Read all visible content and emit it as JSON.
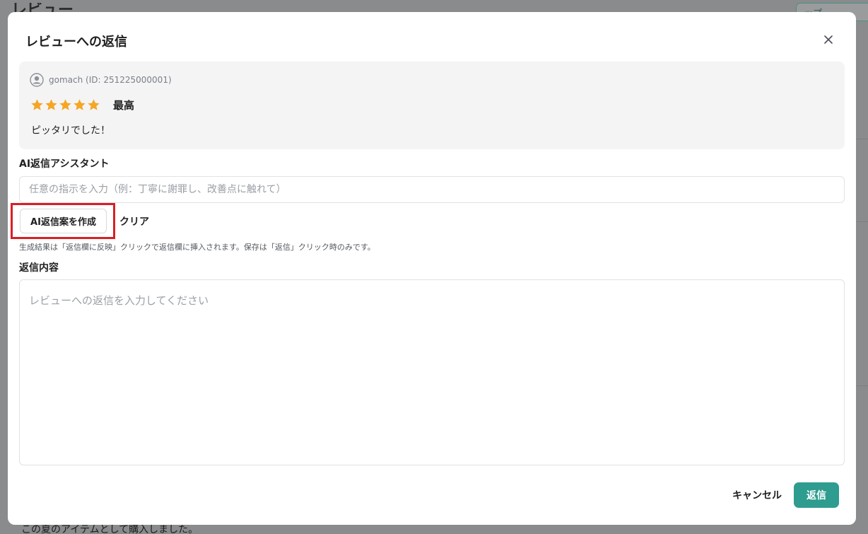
{
  "background": {
    "title": "レビュー",
    "top_button": "ップ",
    "bottom_text": "この夏のアイテムとして購入しました。"
  },
  "modal": {
    "title": "レビューへの返信",
    "close_icon": "close-icon"
  },
  "review": {
    "reviewer": "gomach (ID: 251225000001)",
    "rating": 5,
    "rating_label": "最高",
    "body": "ピッタリでした！",
    "star_color": "#f5a623"
  },
  "ai_assistant": {
    "label": "AI返信アシスタント",
    "input_value": "",
    "input_placeholder": "任意の指示を入力（例：丁寧に謝罪し、改善点に触れて）",
    "generate_label": "AI返信案を作成",
    "clear_label": "クリア",
    "helper_text": "生成結果は「返信欄に反映」クリックで返信欄に挿入されます。保存は「返信」クリック時のみです。"
  },
  "reply": {
    "label": "返信内容",
    "value": "",
    "placeholder": "レビューへの返信を入力してください"
  },
  "footer": {
    "cancel_label": "キャンセル",
    "submit_label": "返信"
  },
  "colors": {
    "accent": "#2e9c8f",
    "highlight": "#d81f26"
  }
}
